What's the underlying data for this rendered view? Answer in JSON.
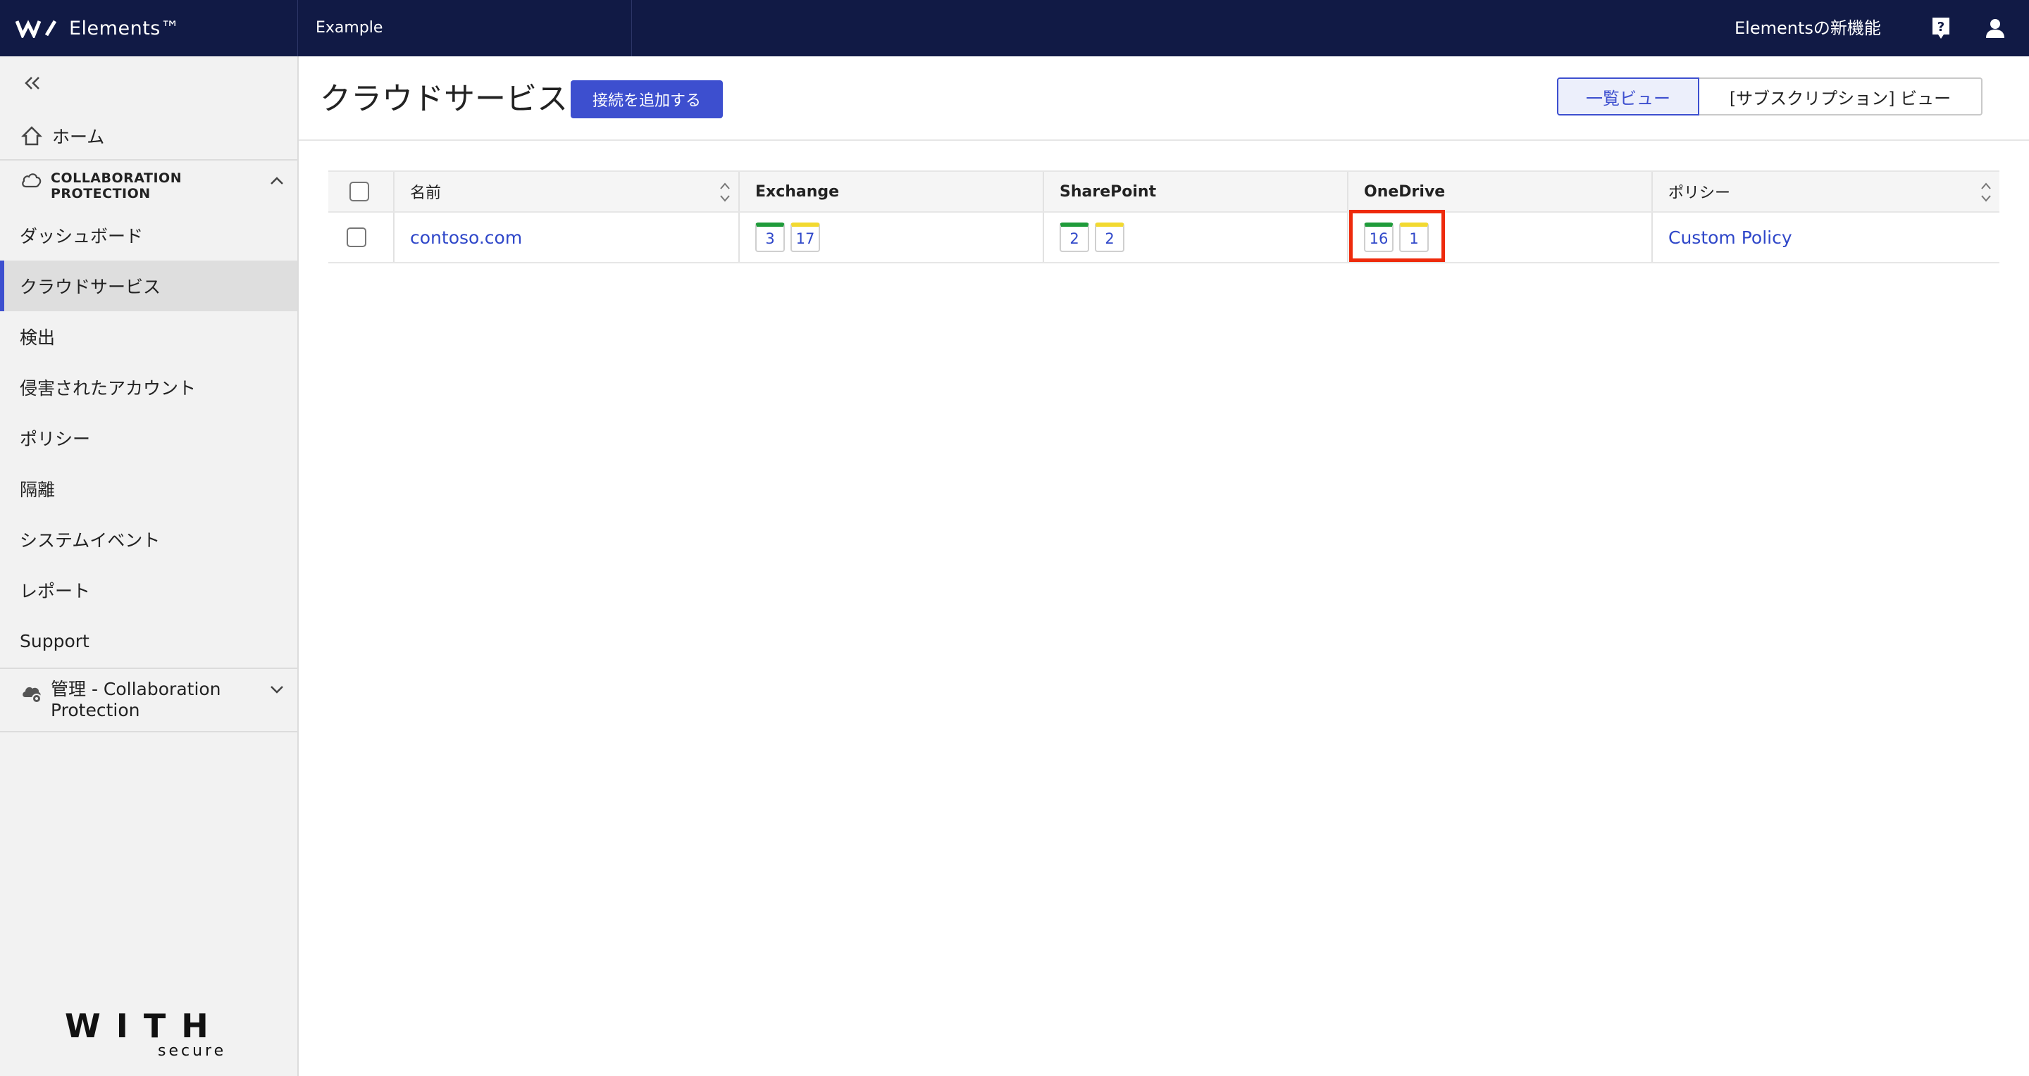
{
  "topbar": {
    "app_name": "Elements™",
    "context": "Example",
    "whats_new": "Elementsの新機能"
  },
  "sidebar": {
    "home": "ホーム",
    "section_title": "COLLABORATION PROTECTION",
    "items": [
      "ダッシュボード",
      "クラウドサービス",
      "検出",
      "侵害されたアカウント",
      "ポリシー",
      "隔離",
      "システムイベント",
      "レポート",
      "Support"
    ],
    "active_item": "クラウドサービス",
    "admin_section": "管理 - Collaboration Protection",
    "brand_main": "WITH",
    "brand_sub": "secure"
  },
  "header": {
    "title": "クラウドサービス",
    "add_button": "接続を追加する",
    "views": [
      "一覧ビュー",
      "[サブスクリプション] ビュー"
    ],
    "active_view": "一覧ビュー"
  },
  "table": {
    "columns": [
      "名前",
      "Exchange",
      "SharePoint",
      "OneDrive",
      "ポリシー"
    ],
    "rows": [
      {
        "name": "contoso.com",
        "exchange": [
          "3",
          "17"
        ],
        "sharepoint": [
          "2",
          "2"
        ],
        "onedrive": [
          "16",
          "1"
        ],
        "policy": "Custom Policy"
      }
    ]
  },
  "colors": {
    "topbar_bg": "#111a45",
    "accent": "#3d4fcf",
    "badge_green": "#1f9b3a",
    "badge_yellow": "#f2d930",
    "highlight": "#ee2a0c"
  }
}
